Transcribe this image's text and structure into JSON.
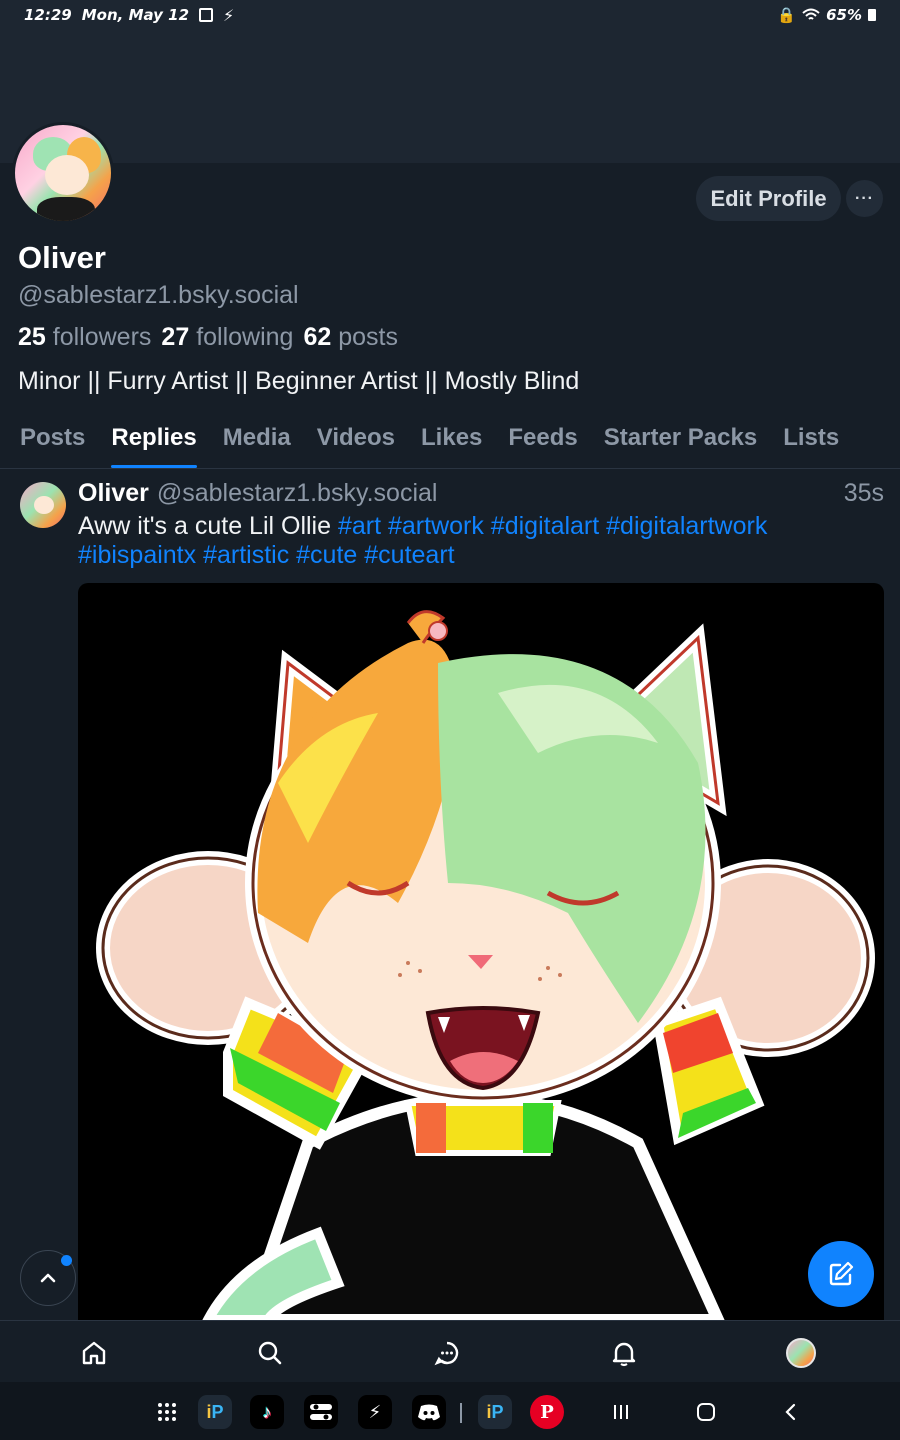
{
  "status_bar": {
    "time": "12:29",
    "date": "Mon, May 12",
    "battery": "65%"
  },
  "profile": {
    "name": "Oliver",
    "handle": "@sablestarz1.bsky.social",
    "followers_count": "25",
    "followers_label": "followers",
    "following_count": "27",
    "following_label": "following",
    "posts_count": "62",
    "posts_label": "posts",
    "bio": "Minor || Furry Artist || Beginner Artist || Mostly Blind",
    "edit_label": "Edit Profile",
    "more_label": "···"
  },
  "tabs": [
    {
      "label": "Posts"
    },
    {
      "label": "Replies",
      "active": true
    },
    {
      "label": "Media"
    },
    {
      "label": "Videos"
    },
    {
      "label": "Likes"
    },
    {
      "label": "Feeds"
    },
    {
      "label": "Starter Packs"
    },
    {
      "label": "Lists"
    }
  ],
  "post": {
    "author": "Oliver",
    "handle": "@sablestarz1.bsky.social",
    "time": "35s",
    "text": "Aww it's a cute Lil Ollie",
    "hashtags_line1": "#art #artwork #digitalart #digitalartwork",
    "hashtags_line2": "#ibispaintx #artistic #cute #cuteart"
  },
  "colors": {
    "accent": "#1083fe",
    "background": "#161e27",
    "muted": "#8d98a6"
  },
  "bottom_nav": [
    "home-icon",
    "search-icon",
    "chat-icon",
    "bell-icon",
    "profile-avatar"
  ],
  "taskbar_apps": [
    "app-drawer",
    "ibispaint",
    "tiktok",
    "toggle-app",
    "power-app",
    "discord",
    "ibispaint-recent",
    "pinterest-recent"
  ]
}
